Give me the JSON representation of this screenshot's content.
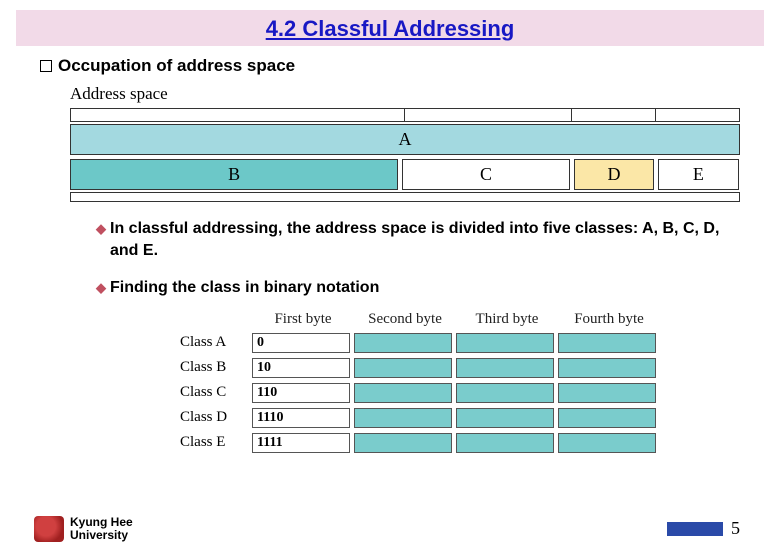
{
  "title": "4.2 Classful Addressing",
  "section": "Occupation of  address space",
  "address_space_label": "Address space",
  "classes": {
    "a": "A",
    "b": "B",
    "c": "C",
    "d": "D",
    "e": "E"
  },
  "bullet1": "In classful addressing, the address space is divided into five classes: A, B, C, D, and E.",
  "bullet2": "Finding the class in binary notation",
  "table": {
    "headers": [
      "First byte",
      "Second byte",
      "Third byte",
      "Fourth byte"
    ],
    "rows": [
      {
        "label": "Class A",
        "prefix": "0"
      },
      {
        "label": "Class B",
        "prefix": "10"
      },
      {
        "label": "Class C",
        "prefix": "110"
      },
      {
        "label": "Class D",
        "prefix": "1110"
      },
      {
        "label": "Class E",
        "prefix": "1111"
      }
    ]
  },
  "footer": {
    "line1": "Kyung Hee",
    "line2": "University",
    "page": "5"
  }
}
